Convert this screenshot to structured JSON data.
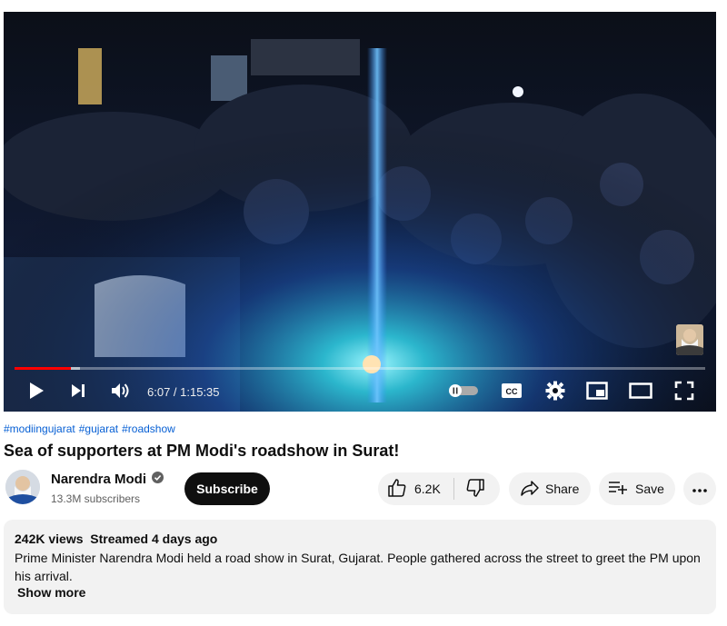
{
  "player": {
    "time_display": "6:07 / 1:15:35",
    "progress_played": 0.081,
    "progress_buffered": 0.095,
    "accent_color": "#ff0000",
    "autoplay_on": false
  },
  "video": {
    "hashtags": [
      "#modiingujarat",
      "#gujarat",
      "#roadshow"
    ],
    "title": "Sea of supporters at PM Modi's roadshow in Surat!"
  },
  "channel": {
    "name": "Narendra Modi",
    "subscribers": "13.3M subscribers",
    "verified": true,
    "subscribe_label": "Subscribe"
  },
  "actions": {
    "likes": "6.2K",
    "share_label": "Share",
    "save_label": "Save"
  },
  "description": {
    "views": "242K views",
    "streamed": "Streamed 4 days ago",
    "text": "Prime Minister Narendra Modi held a road show in Surat, Gujarat. People gathered across the street to greet the PM upon his arrival.",
    "show_more_label": "Show more"
  },
  "icons": [
    "play-icon",
    "next-icon",
    "volume-icon",
    "autoplay-toggle-icon",
    "cc-icon",
    "settings-icon",
    "miniplayer-icon",
    "theater-icon",
    "fullscreen-icon",
    "verified-icon",
    "like-icon",
    "dislike-icon",
    "share-icon",
    "save-icon",
    "more-icon"
  ],
  "colors": {
    "hashtag": "#065fd4",
    "button_dark": "#0f0f0f",
    "pill_bg": "#f2f2f2"
  }
}
